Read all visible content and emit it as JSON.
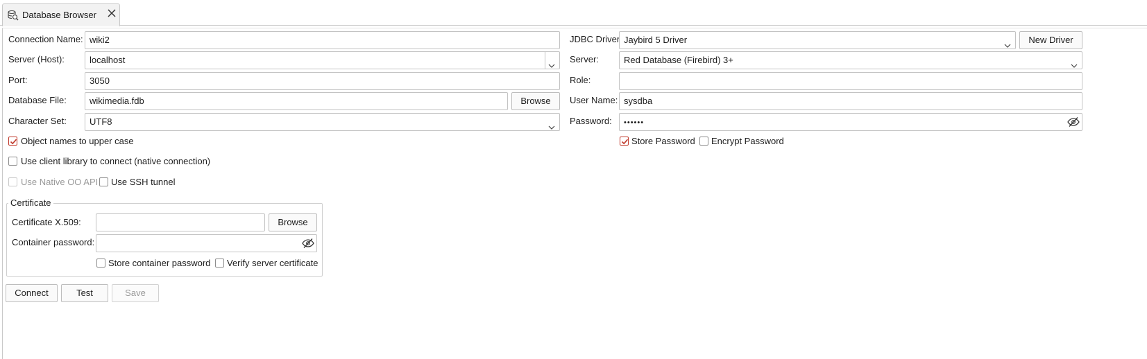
{
  "tab": {
    "title": "Database Browser",
    "icon": "database-search-icon",
    "close_icon": "close-icon"
  },
  "left": {
    "connection_name": {
      "label": "Connection Name:",
      "value": "wiki2"
    },
    "server_host": {
      "label": "Server (Host):",
      "value": "localhost"
    },
    "port": {
      "label": "Port:",
      "value": "3050"
    },
    "database_file": {
      "label": "Database File:",
      "value": "wikimedia.fdb",
      "browse": "Browse"
    },
    "character_set": {
      "label": "Character Set:",
      "value": "UTF8"
    },
    "upper_case": {
      "label": "Object names to upper case",
      "checked": true
    },
    "native_connection": {
      "label": "Use client library to connect (native connection)",
      "checked": false
    },
    "native_oo_api": {
      "label": "Use Native OO API",
      "checked": false,
      "enabled": false
    },
    "ssh_tunnel": {
      "label": "Use SSH tunnel",
      "checked": false
    }
  },
  "right": {
    "jdbc_driver": {
      "label": "JDBC Driver:",
      "value": "Jaybird 5 Driver",
      "new_driver": "New Driver"
    },
    "server": {
      "label": "Server:",
      "value": "Red Database (Firebird) 3+"
    },
    "role": {
      "label": "Role:",
      "value": ""
    },
    "user_name": {
      "label": "User Name:",
      "value": "sysdba"
    },
    "password": {
      "label": "Password:",
      "value": "••••••",
      "eye_icon": "hide-password-icon"
    },
    "store_password": {
      "label": "Store Password",
      "checked": true
    },
    "encrypt_password": {
      "label": "Encrypt Password",
      "checked": false
    }
  },
  "certificate": {
    "title": "Certificate",
    "x509": {
      "label": "Certificate X.509:",
      "value": "",
      "browse": "Browse"
    },
    "container_password": {
      "label": "Container password:",
      "value": ""
    },
    "store_container_password": {
      "label": "Store container password",
      "checked": false
    },
    "verify_server_certificate": {
      "label": "Verify server certificate",
      "checked": false
    }
  },
  "actions": {
    "connect": "Connect",
    "test": "Test",
    "save": "Save"
  },
  "colors": {
    "accent": "#c0392b",
    "border": "#c3c3c3",
    "disabled_text": "#9a9a9a"
  }
}
